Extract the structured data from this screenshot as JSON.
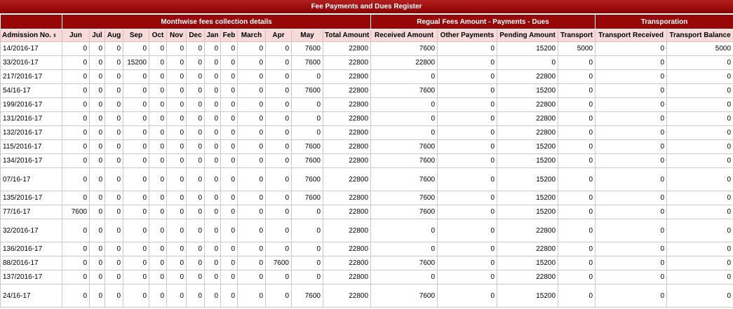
{
  "title": "Fee Payments and Dues Register",
  "groups": [
    {
      "label": "",
      "span": 1
    },
    {
      "label": "Monthwise fees collection details",
      "span": 13
    },
    {
      "label": "Regual Fees Amount - Payments - Dues",
      "span": 4
    },
    {
      "label": "Transporation",
      "span": 2
    }
  ],
  "columns": [
    "Admission No.",
    "Jun",
    "Jul",
    "Aug",
    "Sep",
    "Oct",
    "Nov",
    "Dec",
    "Jan",
    "Feb",
    "March",
    "Apr",
    "May",
    "Total Amount",
    "Received Amount",
    "Other Payments",
    "Pending Amount",
    "Transport",
    "Transport Received",
    "Transport Balance"
  ],
  "sort_icon": "sort-icon",
  "rows": [
    {
      "tall": false,
      "cells": [
        "14/2016-17",
        "0",
        "0",
        "0",
        "0",
        "0",
        "0",
        "0",
        "0",
        "0",
        "0",
        "0",
        "7600",
        "22800",
        "7600",
        "0",
        "15200",
        "5000",
        "0",
        "5000"
      ]
    },
    {
      "tall": false,
      "cells": [
        "33/2016-17",
        "0",
        "0",
        "0",
        "15200",
        "0",
        "0",
        "0",
        "0",
        "0",
        "0",
        "0",
        "7600",
        "22800",
        "22800",
        "0",
        "0",
        "0",
        "0",
        "0"
      ]
    },
    {
      "tall": false,
      "cells": [
        "217/2016-17",
        "0",
        "0",
        "0",
        "0",
        "0",
        "0",
        "0",
        "0",
        "0",
        "0",
        "0",
        "0",
        "22800",
        "0",
        "0",
        "22800",
        "0",
        "0",
        "0"
      ]
    },
    {
      "tall": false,
      "cells": [
        "54/16-17",
        "0",
        "0",
        "0",
        "0",
        "0",
        "0",
        "0",
        "0",
        "0",
        "0",
        "0",
        "7600",
        "22800",
        "7600",
        "0",
        "15200",
        "0",
        "0",
        "0"
      ]
    },
    {
      "tall": false,
      "cells": [
        "199/2016-17",
        "0",
        "0",
        "0",
        "0",
        "0",
        "0",
        "0",
        "0",
        "0",
        "0",
        "0",
        "0",
        "22800",
        "0",
        "0",
        "22800",
        "0",
        "0",
        "0"
      ]
    },
    {
      "tall": false,
      "cells": [
        "131/2016-17",
        "0",
        "0",
        "0",
        "0",
        "0",
        "0",
        "0",
        "0",
        "0",
        "0",
        "0",
        "0",
        "22800",
        "0",
        "0",
        "22800",
        "0",
        "0",
        "0"
      ]
    },
    {
      "tall": false,
      "cells": [
        "132/2016-17",
        "0",
        "0",
        "0",
        "0",
        "0",
        "0",
        "0",
        "0",
        "0",
        "0",
        "0",
        "0",
        "22800",
        "0",
        "0",
        "22800",
        "0",
        "0",
        "0"
      ]
    },
    {
      "tall": false,
      "cells": [
        "115/2016-17",
        "0",
        "0",
        "0",
        "0",
        "0",
        "0",
        "0",
        "0",
        "0",
        "0",
        "0",
        "7600",
        "22800",
        "7600",
        "0",
        "15200",
        "0",
        "0",
        "0"
      ]
    },
    {
      "tall": false,
      "cells": [
        "134/2016-17",
        "0",
        "0",
        "0",
        "0",
        "0",
        "0",
        "0",
        "0",
        "0",
        "0",
        "0",
        "7600",
        "22800",
        "7600",
        "0",
        "15200",
        "0",
        "0",
        "0"
      ]
    },
    {
      "tall": true,
      "cells": [
        "07/16-17",
        "0",
        "0",
        "0",
        "0",
        "0",
        "0",
        "0",
        "0",
        "0",
        "0",
        "0",
        "7600",
        "22800",
        "7600",
        "0",
        "15200",
        "0",
        "0",
        "0"
      ]
    },
    {
      "tall": false,
      "cells": [
        "135/2016-17",
        "0",
        "0",
        "0",
        "0",
        "0",
        "0",
        "0",
        "0",
        "0",
        "0",
        "0",
        "7600",
        "22800",
        "7600",
        "0",
        "15200",
        "0",
        "0",
        "0"
      ]
    },
    {
      "tall": false,
      "cells": [
        "77/16-17",
        "7600",
        "0",
        "0",
        "0",
        "0",
        "0",
        "0",
        "0",
        "0",
        "0",
        "0",
        "0",
        "22800",
        "7600",
        "0",
        "15200",
        "0",
        "0",
        "0"
      ]
    },
    {
      "tall": true,
      "cells": [
        "32/2016-17",
        "0",
        "0",
        "0",
        "0",
        "0",
        "0",
        "0",
        "0",
        "0",
        "0",
        "0",
        "0",
        "22800",
        "0",
        "0",
        "22800",
        "0",
        "0",
        "0"
      ]
    },
    {
      "tall": false,
      "cells": [
        "136/2016-17",
        "0",
        "0",
        "0",
        "0",
        "0",
        "0",
        "0",
        "0",
        "0",
        "0",
        "0",
        "0",
        "22800",
        "0",
        "0",
        "22800",
        "0",
        "0",
        "0"
      ]
    },
    {
      "tall": false,
      "cells": [
        "88/2016-17",
        "0",
        "0",
        "0",
        "0",
        "0",
        "0",
        "0",
        "0",
        "0",
        "0",
        "7600",
        "0",
        "22800",
        "7600",
        "0",
        "15200",
        "0",
        "0",
        "0"
      ]
    },
    {
      "tall": false,
      "cells": [
        "137/2016-17",
        "0",
        "0",
        "0",
        "0",
        "0",
        "0",
        "0",
        "0",
        "0",
        "0",
        "0",
        "0",
        "22800",
        "0",
        "0",
        "22800",
        "0",
        "0",
        "0"
      ]
    },
    {
      "tall": true,
      "cells": [
        "24/16-17",
        "0",
        "0",
        "0",
        "0",
        "0",
        "0",
        "0",
        "0",
        "0",
        "0",
        "0",
        "7600",
        "22800",
        "7600",
        "0",
        "15200",
        "0",
        "0",
        "0"
      ]
    }
  ]
}
